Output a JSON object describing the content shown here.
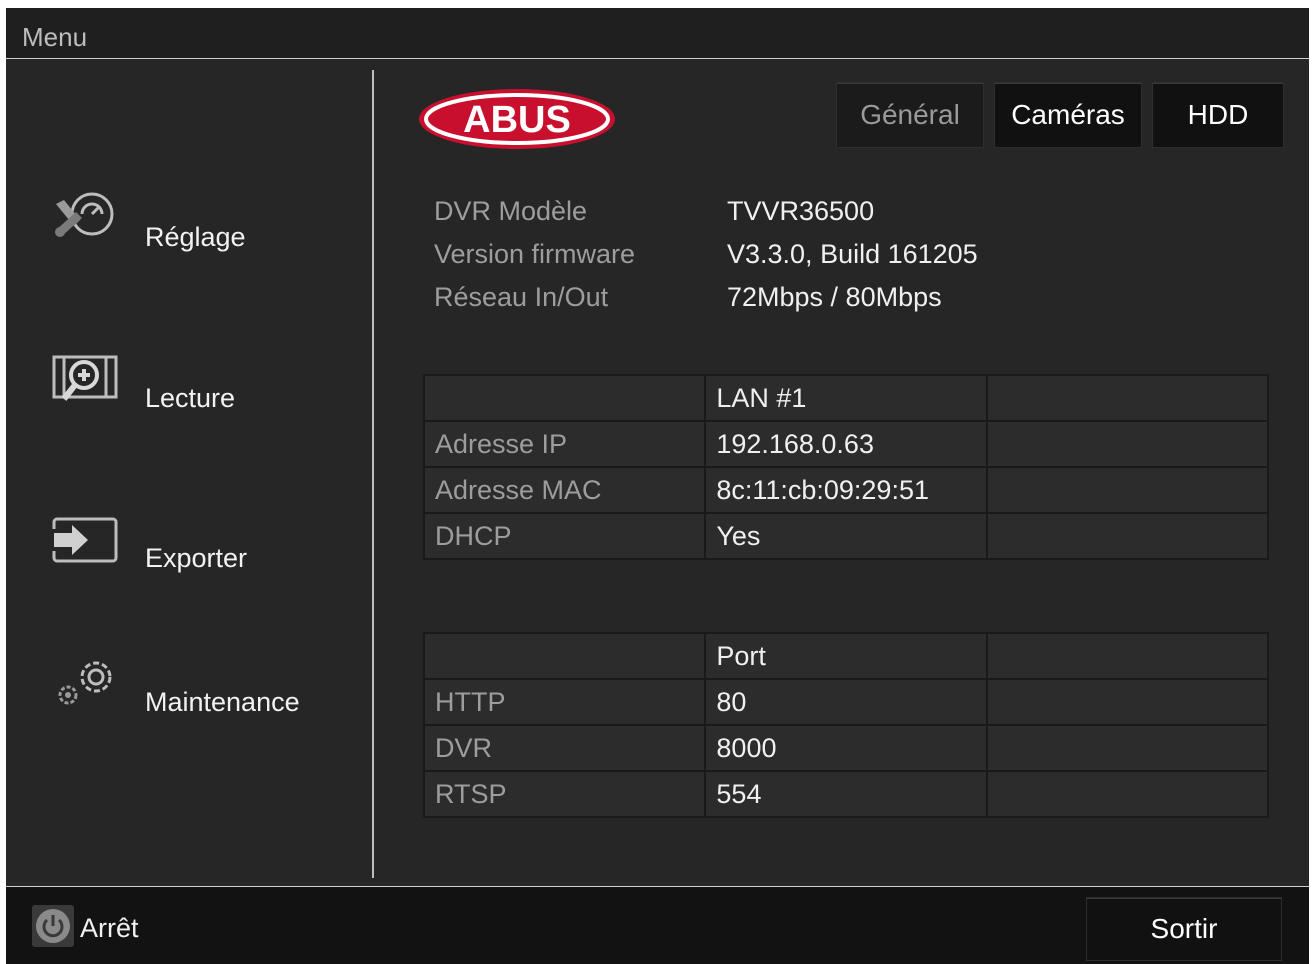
{
  "titlebar": {
    "title": "Menu"
  },
  "logo": {
    "text": "ABUS"
  },
  "sidebar": {
    "items": [
      {
        "label": "Réglage",
        "icon": "settings-tools-icon"
      },
      {
        "label": "Lecture",
        "icon": "playback-film-icon"
      },
      {
        "label": "Exporter",
        "icon": "export-icon"
      },
      {
        "label": "Maintenance",
        "icon": "gears-icon"
      }
    ]
  },
  "tabs": [
    {
      "label": "Général",
      "active": true
    },
    {
      "label": "Caméras",
      "active": false
    },
    {
      "label": "HDD",
      "active": false
    }
  ],
  "info": {
    "rows": [
      {
        "key": "DVR Modèle",
        "value": "TVVR36500"
      },
      {
        "key": "Version firmware",
        "value": "V3.3.0, Build 161205"
      },
      {
        "key": "Réseau In/Out",
        "value": "72Mbps / 80Mbps"
      }
    ]
  },
  "lan_table": {
    "header": "LAN #1",
    "rows": [
      {
        "label": "Adresse IP",
        "value": "192.168.0.63"
      },
      {
        "label": "Adresse MAC",
        "value": "8c:11:cb:09:29:51"
      },
      {
        "label": "DHCP",
        "value": "Yes"
      }
    ]
  },
  "port_table": {
    "header": "Port",
    "rows": [
      {
        "label": "HTTP",
        "value": "80"
      },
      {
        "label": "DVR",
        "value": "8000"
      },
      {
        "label": "RTSP",
        "value": "554"
      }
    ]
  },
  "bottom": {
    "power_label": "Arrêt",
    "exit_label": "Sortir"
  },
  "colors": {
    "logo_red": "#c8102e",
    "panel_bg": "#262626",
    "cell_bg": "#2c2c2c"
  }
}
